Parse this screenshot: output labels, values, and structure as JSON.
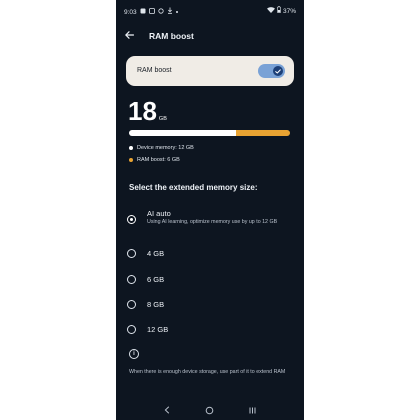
{
  "status_bar": {
    "time": "9:03",
    "battery": "37%"
  },
  "app_bar": {
    "title": "RAM boost",
    "back_icon": "arrow-left-icon"
  },
  "toggle_card": {
    "label": "RAM boost",
    "enabled": true
  },
  "memory": {
    "total_value": "18",
    "total_unit": "GB",
    "device_fraction": 0.667,
    "boost_fraction": 0.333,
    "device_label": "Device memory: 12 GB",
    "boost_label": "RAM boost: 6 GB",
    "colors": {
      "device": "#ffffff",
      "boost": "#e8a332"
    }
  },
  "section_title": "Select the extended memory size:",
  "options": [
    {
      "label": "AI auto",
      "description": "Using AI learning, optimize memory use by up to 12 GB",
      "selected": true
    },
    {
      "label": "4 GB",
      "selected": false
    },
    {
      "label": "6 GB",
      "selected": false
    },
    {
      "label": "8 GB",
      "selected": false
    },
    {
      "label": "12 GB",
      "selected": false
    }
  ],
  "info": {
    "icon": "info-icon",
    "text": "When there is enough device storage, use part of it to extend RAM"
  },
  "nav": {
    "back": "nav-back-icon",
    "home": "nav-home-icon",
    "recents": "nav-recents-icon"
  }
}
